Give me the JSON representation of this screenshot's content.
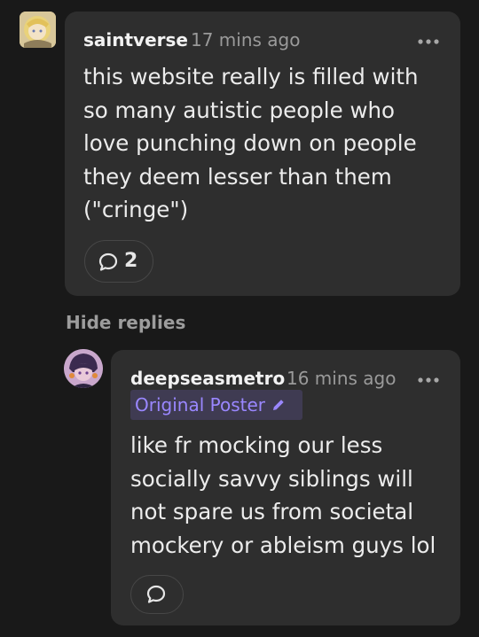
{
  "comments": [
    {
      "username": "saintverse",
      "time": "17 mins ago",
      "text": "this website really is filled with\nso many autistic people who\nlove punching down on people\nthey deem lesser than them\n(\"cringe\")",
      "reply_count": "2",
      "more_icon": "ellipsis-icon"
    },
    {
      "username": "deepseasmetro",
      "time": "16 mins ago",
      "badge": "Original Poster",
      "text": "like fr mocking our less\nsocially savvy siblings will\nnot spare us from societal\nmockery or ableism guys lol",
      "more_icon": "ellipsis-icon"
    }
  ],
  "hide_replies_label": "Hide replies",
  "colors": {
    "background": "#191919",
    "card": "#2e2e2e",
    "badge_bg": "#3f3b52",
    "badge_text": "#9a87ff"
  }
}
